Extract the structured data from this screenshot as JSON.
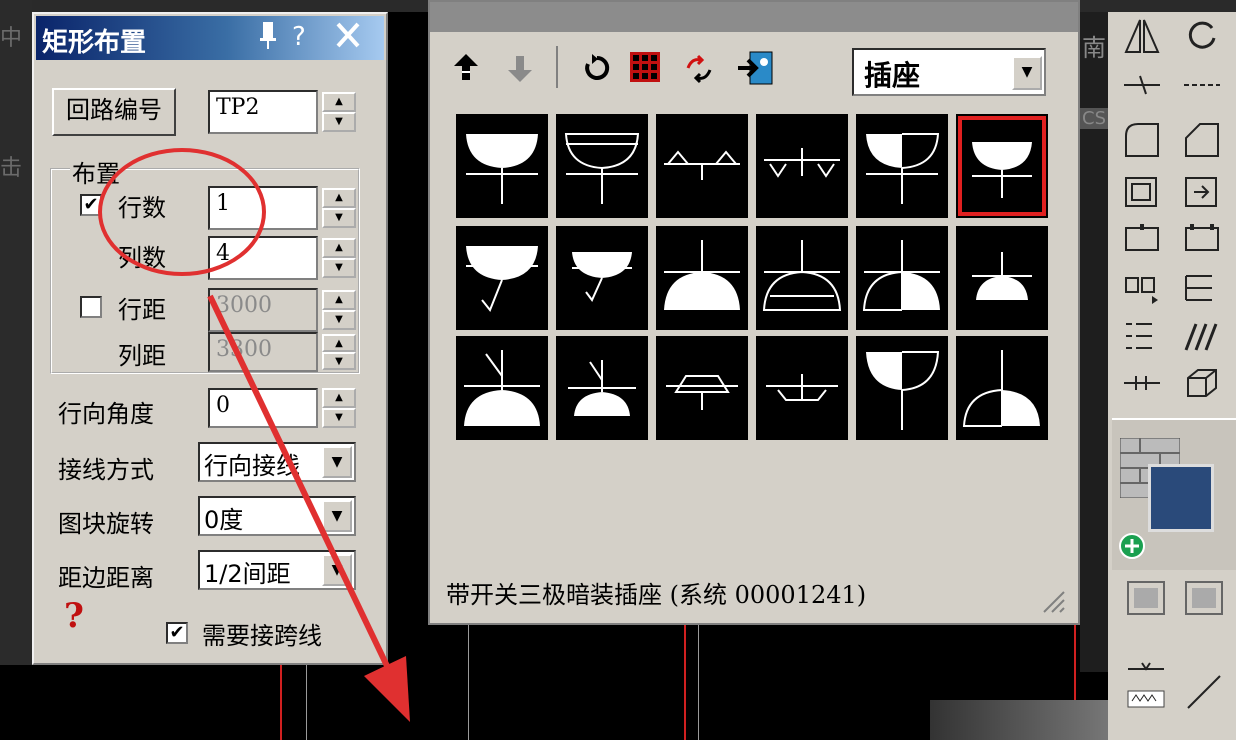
{
  "background": {
    "side_texts": [
      "中",
      "击"
    ],
    "south_label": "南",
    "cs_label": "CS"
  },
  "array_dialog": {
    "title": "矩形布置",
    "circuit_button": "回路编号",
    "circuit_value": "TP2",
    "group_label": "布置",
    "rows": {
      "label": "行数",
      "value": "1",
      "checked": true
    },
    "cols": {
      "label": "列数",
      "value": "4"
    },
    "row_spacing": {
      "label": "行距",
      "value": "3000",
      "checked": false
    },
    "col_spacing": {
      "label": "列距",
      "value": "3300"
    },
    "row_angle": {
      "label": "行向角度",
      "value": "0"
    },
    "wiring": {
      "label": "接线方式",
      "value": "行向接线"
    },
    "rotation": {
      "label": "图块旋转",
      "value": "0度"
    },
    "edge_distance": {
      "label": "距边距离",
      "value": "1/2间距"
    },
    "cross_line": {
      "label": "需要接跨线",
      "checked": true
    },
    "help_glyph": "?"
  },
  "symbol_panel": {
    "category": "插座",
    "status_text": "带开关三极暗装插座  (系统 00001241)",
    "thumbnails": [
      "socket-1",
      "socket-2",
      "socket-3",
      "socket-4",
      "socket-5",
      "socket-6",
      "socket-7",
      "socket-8",
      "socket-9",
      "socket-10",
      "socket-11",
      "socket-12",
      "socket-13",
      "socket-14",
      "socket-15",
      "socket-16",
      "socket-17",
      "socket-18"
    ],
    "selected_index": 5
  },
  "colors": {
    "dialog_bg": "#d4d0c8",
    "title_blue": "#0a246a",
    "highlight_red": "#e02020",
    "annotation_red": "#e03030"
  }
}
